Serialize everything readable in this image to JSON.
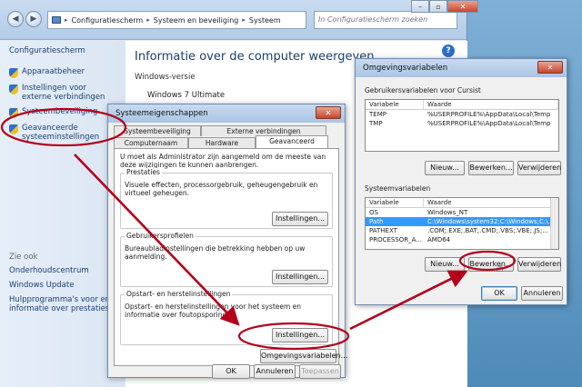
{
  "main_window": {
    "address": [
      "Configuratiescherm",
      "Systeem en beveiliging",
      "Systeem"
    ],
    "search_placeholder": "In Configuratiescherm zoeken",
    "controls": {
      "min": "–",
      "max": "▫",
      "close": "✕"
    },
    "sidebar": {
      "home": "Configuratiescherm",
      "links": [
        {
          "label": "Apparaatbeheer",
          "icon": "shield-icon"
        },
        {
          "label": "Instellingen voor externe verbindingen",
          "icon": "shield-icon"
        },
        {
          "label": "Systeembeveiliging",
          "icon": "shield-icon"
        },
        {
          "label": "Geavanceerde systeeminstellingen",
          "icon": "shield-icon"
        }
      ],
      "see_also_title": "Zie ook",
      "see_also": [
        "Onderhoudscentrum",
        "Windows Update",
        "Hulpprogramma's voor en informatie over prestaties"
      ]
    },
    "content": {
      "heading": "Informatie over de computer weergeven",
      "edition_label": "Windows-versie",
      "edition_value": "Windows 7 Ultimate"
    }
  },
  "system_properties": {
    "title": "Systeemeigenschappen",
    "tabs_row1": [
      "Systeembeveiliging",
      "Externe verbindingen"
    ],
    "tabs_row2": [
      "Computernaam",
      "Hardware",
      "Geavanceerd"
    ],
    "intro": "U moet als Administrator zijn aangemeld om de meeste van deze wijzigingen te kunnen aanbrengen.",
    "groups": [
      {
        "label": "Prestaties",
        "text": "Visuele effecten, processorgebruik, geheugengebruik en virtueel geheugen.",
        "button": "Instellingen..."
      },
      {
        "label": "Gebruikersprofielen",
        "text": "Bureaubladinstellingen die betrekking hebben op uw aanmelding.",
        "button": "Instellingen..."
      },
      {
        "label": "Opstart- en herstelinstellingen",
        "text": "Opstart- en herstelinstellingen voor het systeem en informatie over foutopsporing.",
        "button": "Instellingen..."
      }
    ],
    "env_button": "Omgevingsvariabelen...",
    "ok": "OK",
    "cancel": "Annuleren",
    "apply": "Toepassen"
  },
  "env_vars": {
    "title": "Omgevingsvariabelen",
    "user_title": "Gebruikersvariabelen voor Cursist",
    "columns": [
      "Variabele",
      "Waarde"
    ],
    "user_rows": [
      [
        "TEMP",
        "%USERPROFILE%\\AppData\\Local\\Temp"
      ],
      [
        "TMP",
        "%USERPROFILE%\\AppData\\Local\\Temp"
      ]
    ],
    "system_title": "Systeemvariabelen",
    "system_rows": [
      [
        "OS",
        "Windows_NT"
      ],
      [
        "Path",
        "C:\\Windows\\system32;C:\\Windows;C:\\..."
      ],
      [
        "PATHEXT",
        ".COM;.EXE;.BAT;.CMD;.VBS;.VBE;.JS;..."
      ],
      [
        "PROCESSOR_A...",
        "AMD64"
      ]
    ],
    "selected_system_row": 1,
    "new": "Nieuw...",
    "edit": "Bewerken...",
    "delete": "Verwijderen",
    "ok": "OK",
    "cancel": "Annuleren"
  },
  "colors": {
    "annotation": "#b3001b",
    "selection": "#3399ff"
  }
}
